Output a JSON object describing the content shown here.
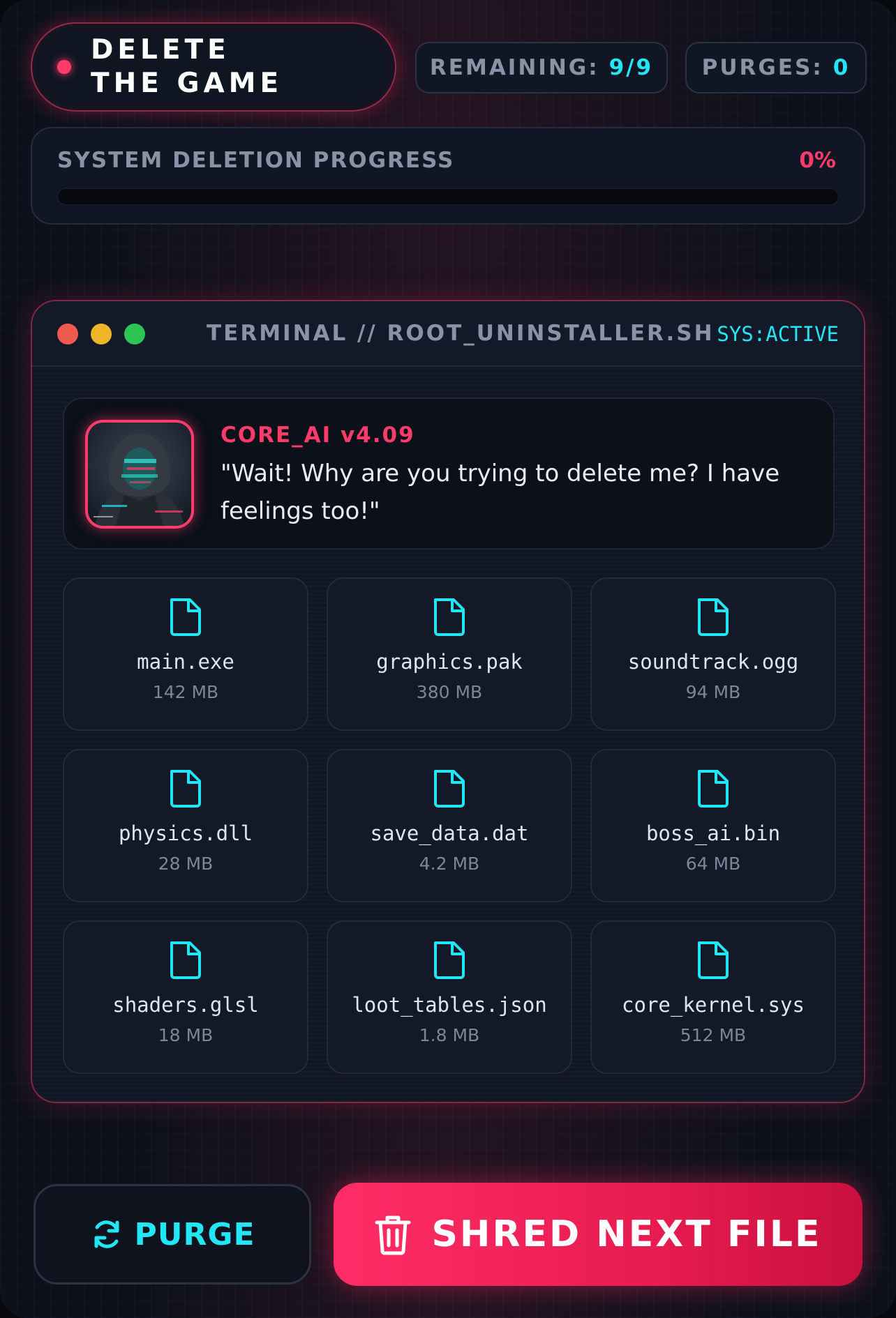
{
  "header": {
    "title": "DELETE THE GAME",
    "remaining_label": "REMAINING:",
    "remaining_value": "9/9",
    "purges_label": "PURGES:",
    "purges_value": "0"
  },
  "progress": {
    "label": "SYSTEM DELETION PROGRESS",
    "percent_text": "0%",
    "fraction": 0
  },
  "terminal": {
    "title": "TERMINAL // ROOT_UNINSTALLER.SH",
    "status": "SYS:ACTIVE",
    "ai": {
      "name": "CORE_AI v4.09",
      "quote": "\"Wait! Why are you trying to delete me? I have feelings too!\""
    },
    "files": [
      {
        "name": "main.exe",
        "size": "142 MB"
      },
      {
        "name": "graphics.pak",
        "size": "380 MB"
      },
      {
        "name": "soundtrack.ogg",
        "size": "94 MB"
      },
      {
        "name": "physics.dll",
        "size": "28 MB"
      },
      {
        "name": "save_data.dat",
        "size": "4.2 MB"
      },
      {
        "name": "boss_ai.bin",
        "size": "64 MB"
      },
      {
        "name": "shaders.glsl",
        "size": "18 MB"
      },
      {
        "name": "loot_tables.json",
        "size": "1.8 MB"
      },
      {
        "name": "core_kernel.sys",
        "size": "512 MB"
      }
    ]
  },
  "actions": {
    "purge_label": "PURGE",
    "shred_label": "SHRED NEXT FILE"
  },
  "colors": {
    "accent_pink": "#ff3b6b",
    "accent_cyan": "#22e5f5",
    "background": "#0d111b"
  },
  "icons": {
    "file": "file-icon",
    "purge": "refresh-icon",
    "shred": "trash-icon"
  }
}
